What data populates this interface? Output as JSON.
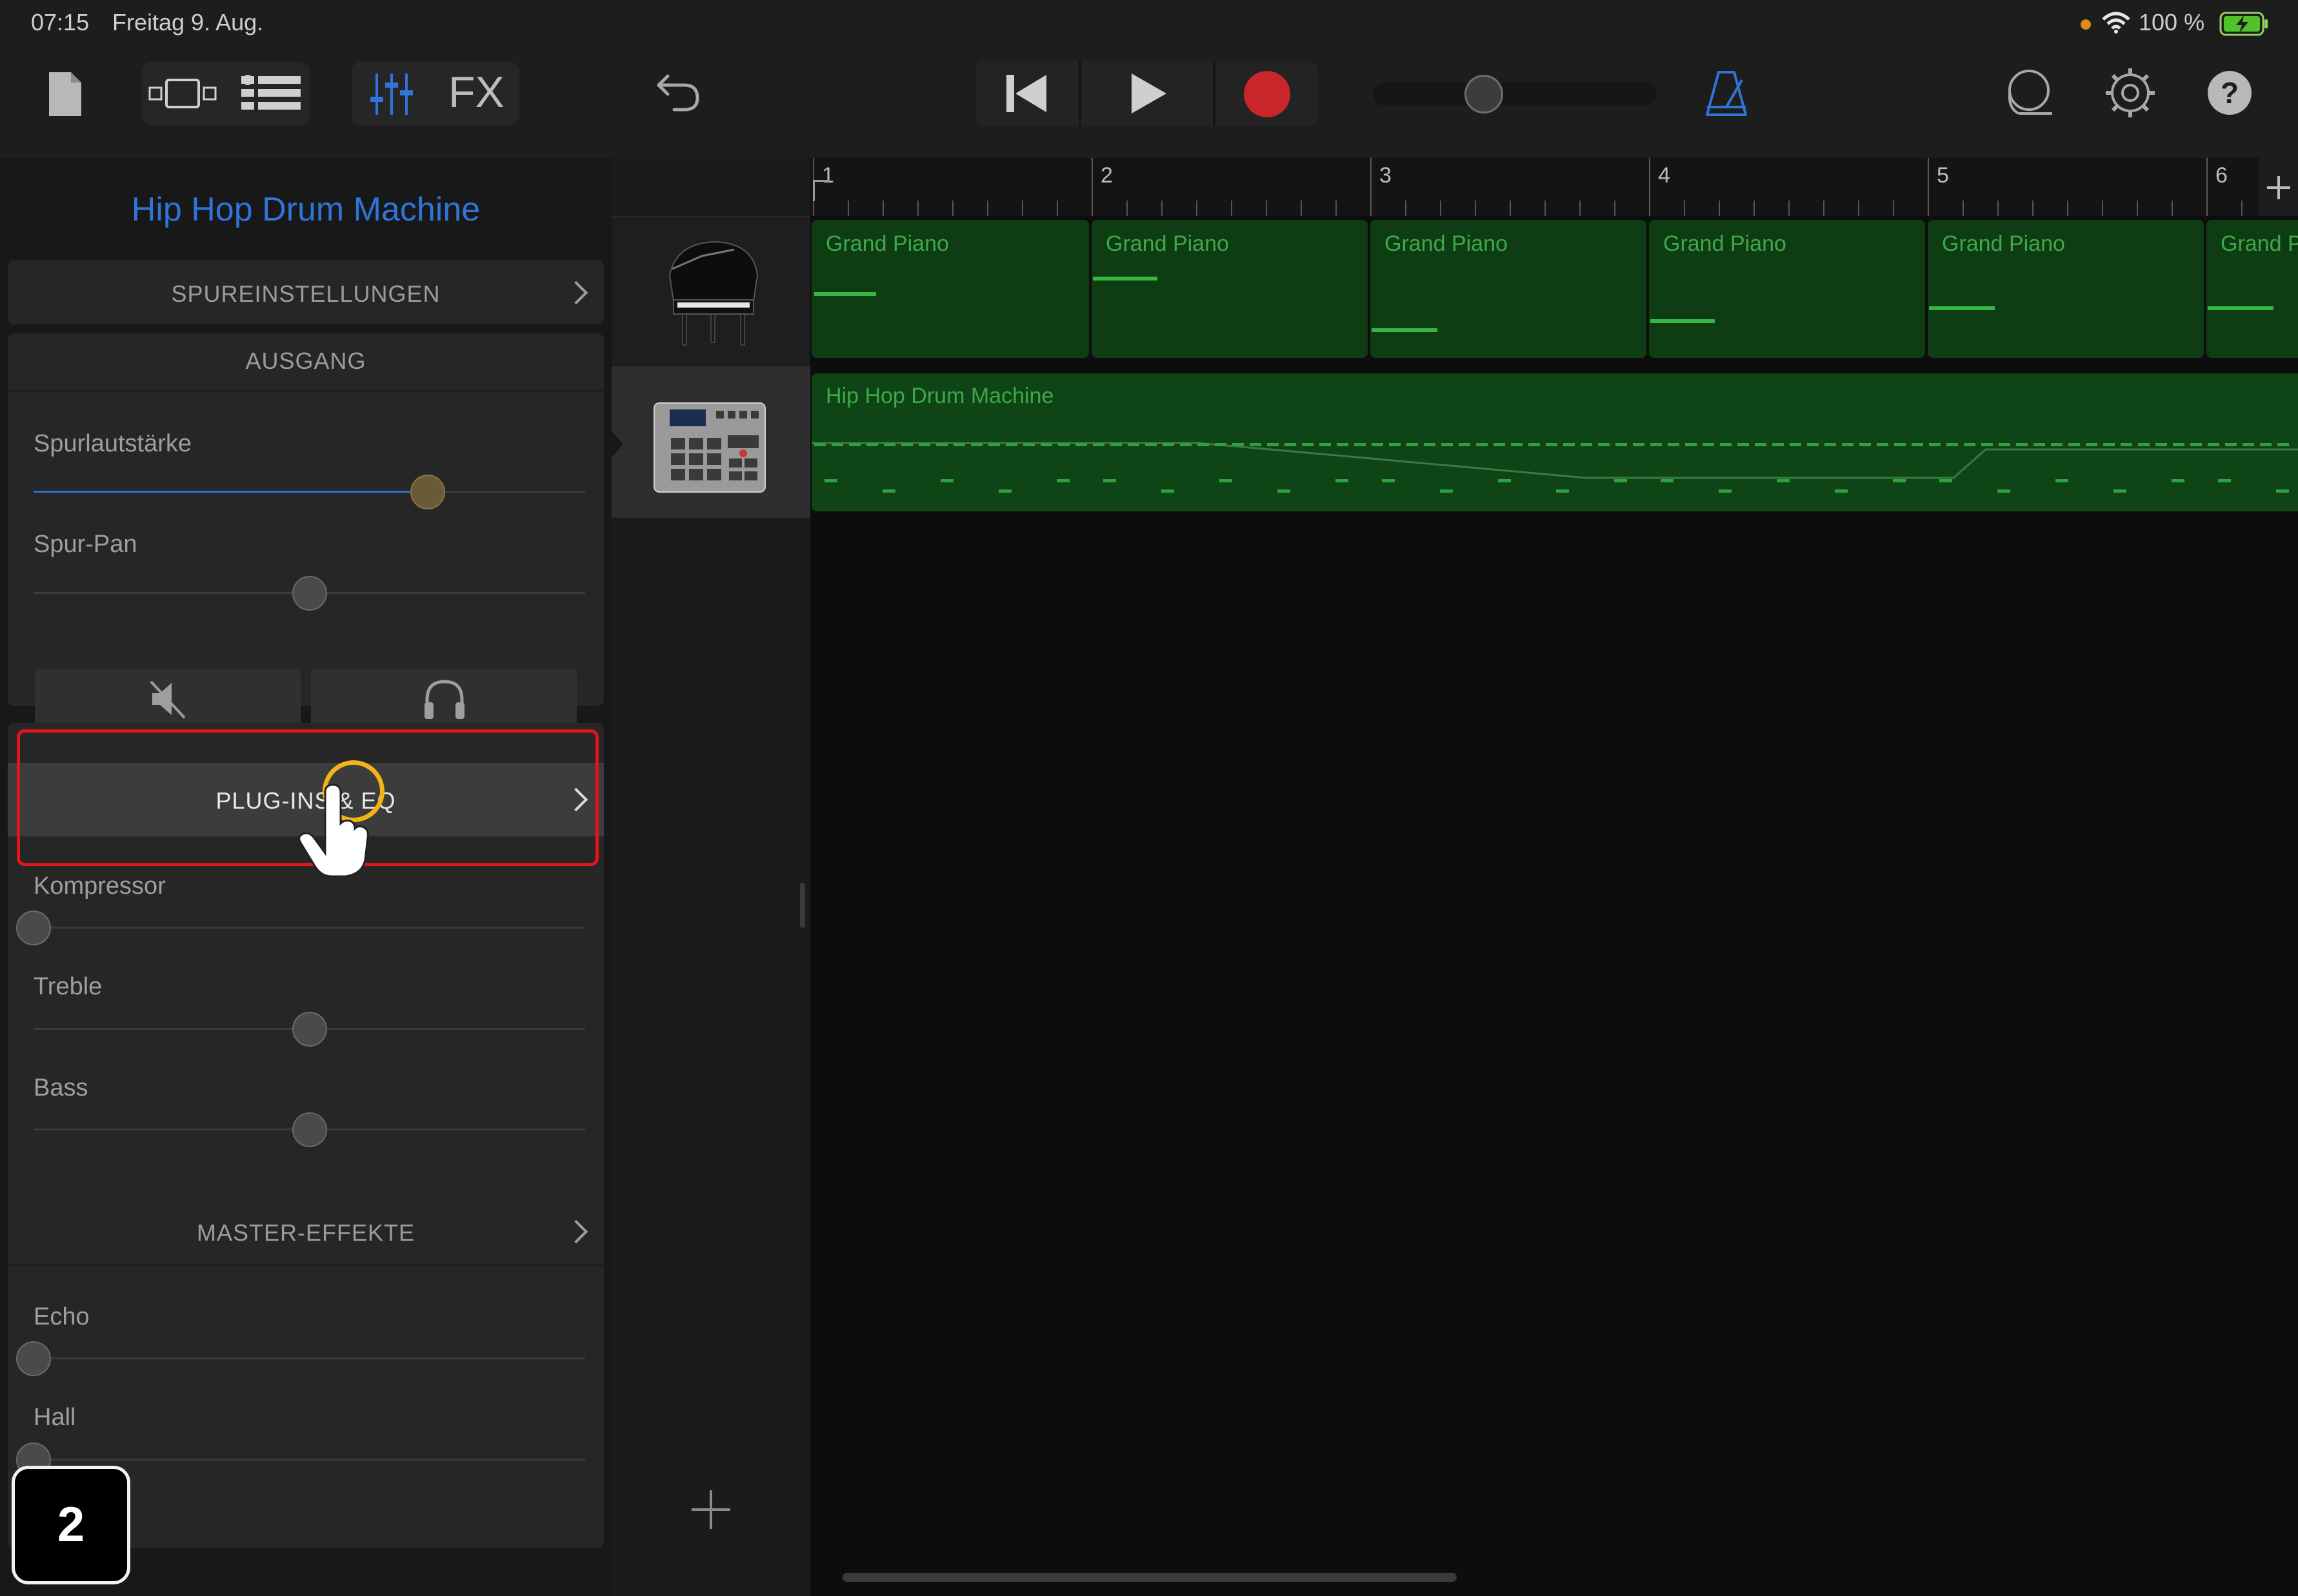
{
  "status_bar": {
    "time": "07:15",
    "date": "Freitag 9. Aug.",
    "battery": "100 %"
  },
  "toolbar": {
    "fx_label": "FX",
    "icons": [
      "document-icon",
      "view-toggle-icon",
      "track-view-icon",
      "mixer-icon",
      "fx-label",
      "undo-icon",
      "rewind-icon",
      "play-icon",
      "record-icon",
      "master-volume-slider",
      "metronome-icon",
      "loop-icon",
      "settings-icon",
      "help-icon"
    ]
  },
  "left_panel": {
    "track_name": "Hip Hop Drum Machine",
    "track_settings": "SPUREINSTELLUNGEN",
    "output": {
      "header": "AUSGANG",
      "volume_label": "Spurlautstärke",
      "volume_value": 0.715,
      "pan_label": "Spur-Pan",
      "pan_value": 0.5
    },
    "plugins": {
      "header": "PLUG-INS & EQ",
      "compressor_label": "Kompressor",
      "compressor_value": 0.0,
      "treble_label": "Treble",
      "treble_value": 0.5,
      "bass_label": "Bass",
      "bass_value": 0.5
    },
    "master": {
      "header": "MASTER-EFFEKTE",
      "echo_label": "Echo",
      "echo_value": 0.0,
      "hall_label": "Hall",
      "hall_value": 0.0
    }
  },
  "step_badge": "2",
  "timeline": {
    "bars": [
      "1",
      "2",
      "3",
      "4",
      "5",
      "6"
    ],
    "piano_regions": [
      "Grand Piano",
      "Grand Piano",
      "Grand Piano",
      "Grand Piano",
      "Grand Piano",
      "Grand P"
    ],
    "drum_region": "Hip Hop Drum Machine"
  },
  "colors": {
    "accent_blue": "#2f74d8",
    "record_red": "#c9262b",
    "highlight_red": "#e0161b",
    "cursor_yellow": "#f3b515",
    "region_green": "#0e3d14"
  }
}
